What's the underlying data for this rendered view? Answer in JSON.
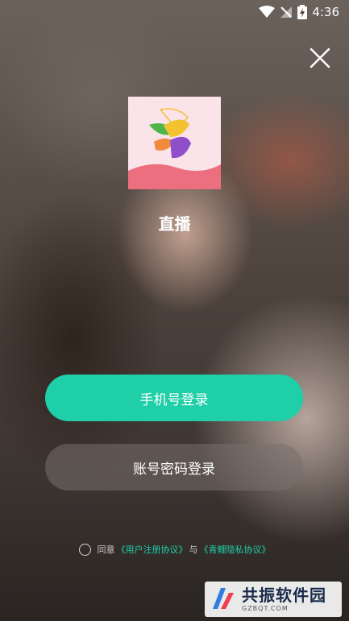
{
  "status_bar": {
    "time": "4:36",
    "icons": [
      "wifi-icon",
      "no-signal-icon",
      "battery-charging-icon"
    ]
  },
  "close_icon": "close-icon",
  "app": {
    "name": "直播",
    "icon": "app-logo-icon",
    "colors": {
      "icon_bg": "#fbe3ea",
      "wave": "#ec6f7f",
      "leaf_green": "#4cb64a",
      "leaf_yellow": "#f2c230",
      "leaf_purple": "#8e4fc9",
      "leaf_orange": "#f08a3c"
    }
  },
  "buttons": {
    "phone_login": "手机号登录",
    "account_login": "账号密码登录"
  },
  "agreement": {
    "prefix": "同意",
    "user_agreement": "《用户注册协议》",
    "connector": "与",
    "privacy_agreement": "《青鲤隐私协议》"
  },
  "watermark": {
    "title": "共振软件园",
    "subtitle": "GZBQT.COM"
  },
  "colors": {
    "accent": "#1ecfa8",
    "secondary_button": "#78706c"
  }
}
